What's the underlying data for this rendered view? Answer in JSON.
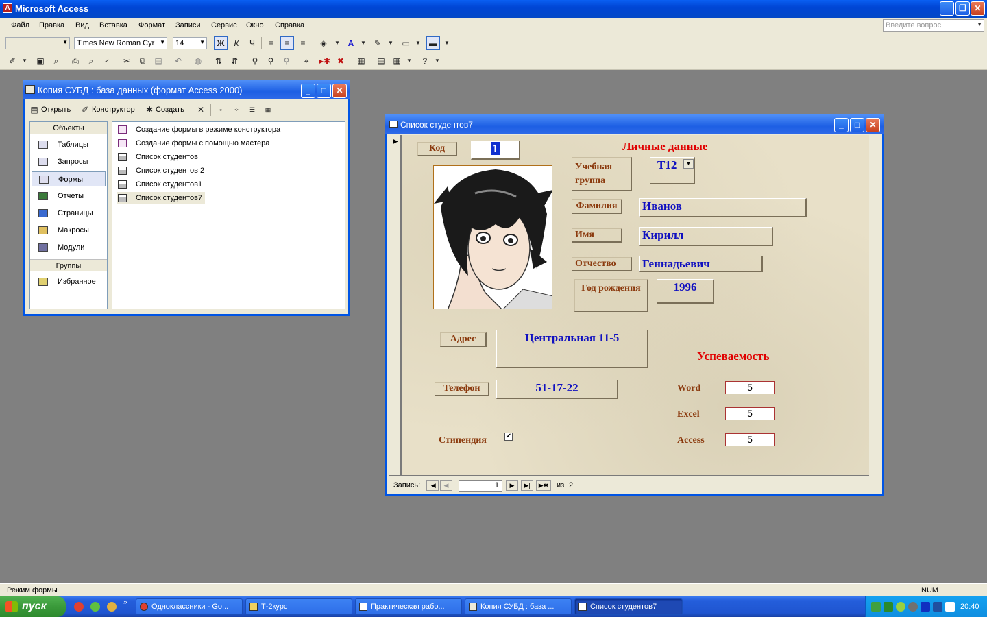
{
  "app": {
    "title": "Microsoft Access"
  },
  "menu": [
    "Файл",
    "Правка",
    "Вид",
    "Вставка",
    "Формат",
    "Записи",
    "Сервис",
    "Окно",
    "Справка"
  ],
  "help_placeholder": "Введите вопрос",
  "toolbar": {
    "font_name": "Times New Roman Cyr",
    "font_size": "14",
    "bold": "Ж",
    "italic": "К",
    "underline": "Ч"
  },
  "dbwindow": {
    "title": "Копия СУБД : база данных (формат Access 2000)",
    "actions": {
      "open": "Открыть",
      "design": "Конструктор",
      "create": "Создать"
    },
    "objects_header": "Объекты",
    "objects": [
      "Таблицы",
      "Запросы",
      "Формы",
      "Отчеты",
      "Страницы",
      "Макросы",
      "Модули"
    ],
    "selected_object": "Формы",
    "groups_header": "Группы",
    "groups": [
      "Избранное"
    ],
    "list": [
      "Создание формы в режиме конструктора",
      "Создание формы с помощью мастера",
      "Список студентов",
      "Список студентов 2",
      "Список студентов1",
      "Список студентов7"
    ],
    "selected_item": "Список студентов7"
  },
  "form": {
    "title": "Список студентов7",
    "labels": {
      "code": "Код",
      "personal": "Личные данные",
      "group": "Учебная группа",
      "surname": "Фамилия",
      "name": "Имя",
      "patronymic": "Отчество",
      "birth_year": "Год рождения",
      "address": "Адрес",
      "phone": "Телефон",
      "stipend": "Стипендия",
      "progress": "Успеваемость",
      "word": "Word",
      "excel": "Excel",
      "access": "Access"
    },
    "values": {
      "code": "1",
      "group": "Т12",
      "surname": "Иванов",
      "name": "Кирилл",
      "patronymic": "Геннадьевич",
      "birth_year": "1996",
      "address": "Центральная 11-5",
      "phone": "51-17-22",
      "stipend": true,
      "word": "5",
      "excel": "5",
      "access": "5"
    },
    "nav": {
      "label": "Запись:",
      "current": "1",
      "of": "из",
      "total": "2"
    }
  },
  "status": {
    "mode": "Режим формы",
    "num": "NUM"
  },
  "taskbar": {
    "start": "пуск",
    "tasks": [
      "Одноклассники - Go...",
      "Т-2курс",
      "Практическая рабо...",
      "Копия СУБД : база ...",
      "Список студентов7"
    ],
    "active_task": "Список студентов7",
    "time": "20:40"
  }
}
